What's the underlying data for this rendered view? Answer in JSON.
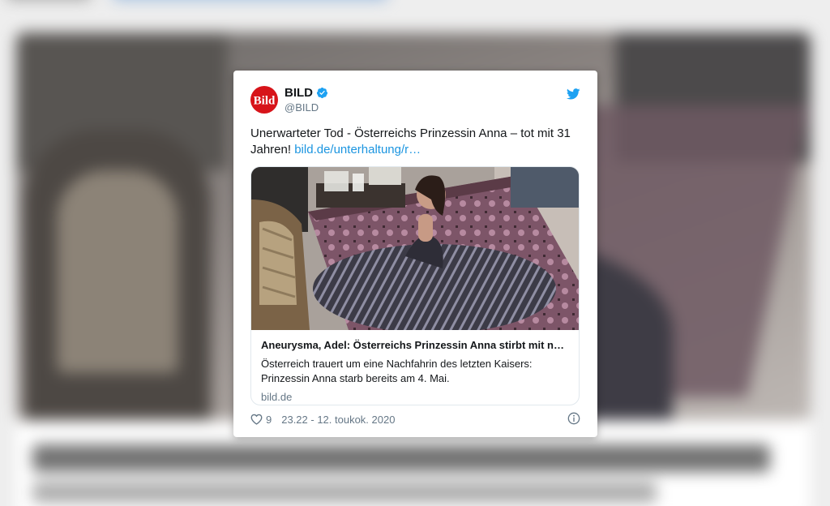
{
  "tweet": {
    "display_name": "BILD",
    "handle": "@BILD",
    "verified": true,
    "avatar_text": "Bild",
    "text": "Unerwarteter Tod - Österreichs Prinzessin Anna – tot mit 31 Jahren!",
    "link_text": "bild.de/unterhaltung/r…",
    "card": {
      "title": "Aneurysma, Adel: Österreichs Prinzessin Anna stirbt mit nur …",
      "description": "Österreich trauert um eine Nachfahrin des letzten Kaisers: Prinzessin Anna starb bereits am 4. Mai.",
      "domain": "bild.de"
    },
    "likes": "9",
    "timestamp": "23.22 - 12. toukok. 2020"
  },
  "icons": {
    "verified": "verified-badge-icon",
    "bird": "twitter-bird-icon",
    "like": "heart-icon",
    "info": "info-icon"
  },
  "colors": {
    "brand_red": "#d7141a",
    "twitter_blue": "#1da1f2",
    "link_blue": "#1b95e0",
    "muted_text": "#657786",
    "text": "#14171a",
    "border": "#e1e8ed"
  }
}
